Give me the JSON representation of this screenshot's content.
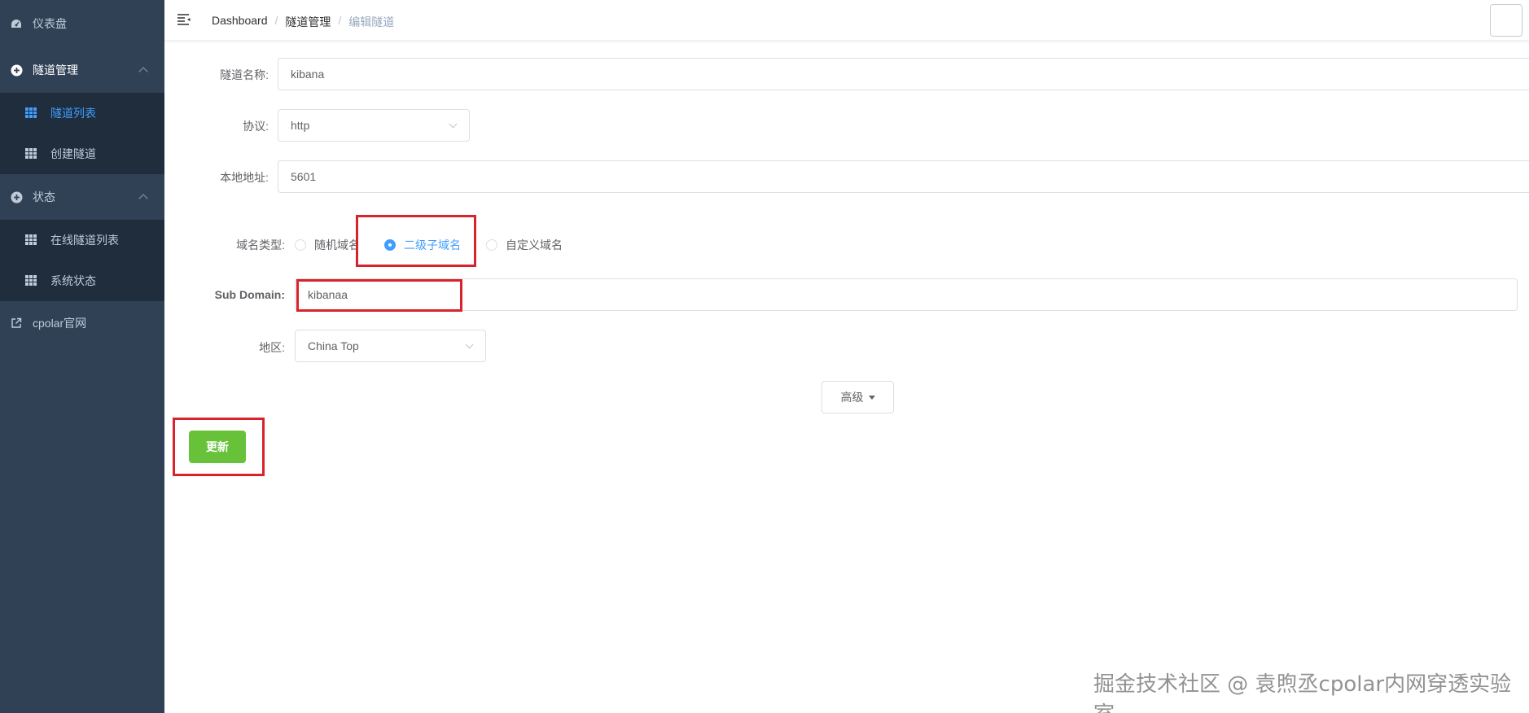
{
  "sidebar": {
    "dashboard": {
      "label": "仪表盘",
      "icon": "dashboard-icon"
    },
    "tunnel_mgmt": {
      "label": "隧道管理",
      "icon": "plus-circle-icon",
      "items": [
        {
          "label": "隧道列表",
          "icon": "grid-icon",
          "active": true
        },
        {
          "label": "创建隧道",
          "icon": "grid-icon",
          "active": false
        }
      ]
    },
    "status": {
      "label": "状态",
      "icon": "plus-circle-icon",
      "items": [
        {
          "label": "在线隧道列表",
          "icon": "grid-icon"
        },
        {
          "label": "系统状态",
          "icon": "grid-icon"
        }
      ]
    },
    "website": {
      "label": "cpolar官网",
      "icon": "external-link-icon"
    }
  },
  "navbar": {
    "breadcrumb": [
      "Dashboard",
      "隧道管理",
      "编辑隧道"
    ]
  },
  "form": {
    "tunnel_name": {
      "label": "隧道名称:",
      "value": "kibana"
    },
    "protocol": {
      "label": "协议:",
      "value": "http"
    },
    "local_address": {
      "label": "本地地址:",
      "value": "5601"
    },
    "domain_type": {
      "label": "域名类型:",
      "options": [
        "随机域名",
        "二级子域名",
        "自定义域名"
      ],
      "selected": "二级子域名"
    },
    "sub_domain": {
      "label": "Sub Domain:",
      "value": "kibanaa"
    },
    "region": {
      "label": "地区:",
      "value": "China Top"
    }
  },
  "buttons": {
    "advanced": "高级",
    "update": "更新"
  },
  "watermark": "掘金技术社区 @ 袁煦丞cpolar内网穿透实验室",
  "colors": {
    "sidebar_bg": "#304156",
    "submenu_bg": "#1f2d3d",
    "accent": "#409eff",
    "success": "#67c23a",
    "highlight": "#d9232a"
  }
}
